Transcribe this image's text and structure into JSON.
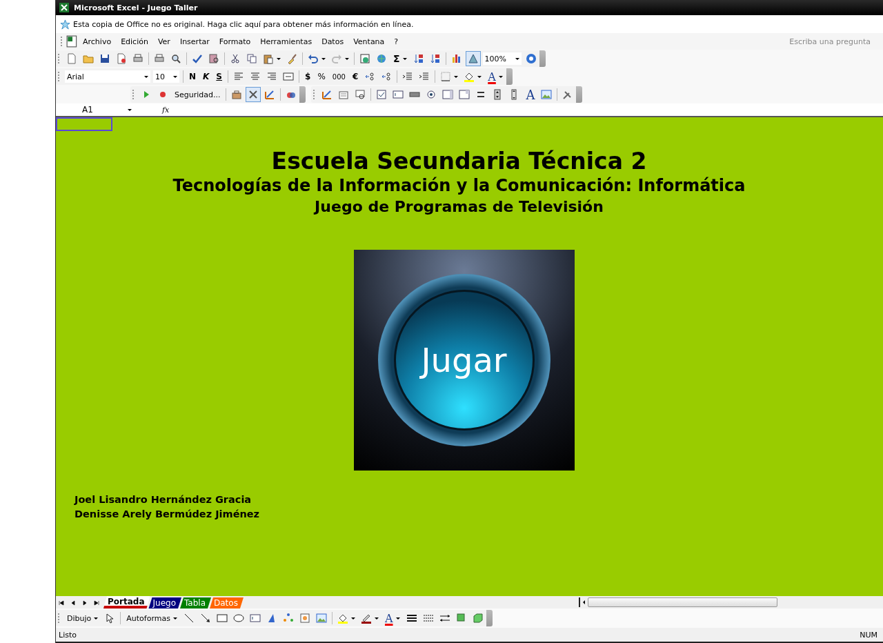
{
  "window": {
    "title": "Microsoft Excel - Juego Taller"
  },
  "notice": {
    "text": "Esta copia de Office no es original.  Haga clic aquí para obtener más información en línea."
  },
  "menu": [
    {
      "label": "Archivo"
    },
    {
      "label": "Edición"
    },
    {
      "label": "Ver"
    },
    {
      "label": "Insertar"
    },
    {
      "label": "Formato"
    },
    {
      "label": "Herramientas"
    },
    {
      "label": "Datos"
    },
    {
      "label": "Ventana"
    },
    {
      "label": "?"
    }
  ],
  "help_box": {
    "placeholder": "Escriba una pregunta"
  },
  "standard_toolbar": {
    "sum": "Σ",
    "zoom": "100%"
  },
  "formatting_toolbar": {
    "font": "Arial",
    "size": "10",
    "bold": "N",
    "italic": "K",
    "underline": "S",
    "currency": "$",
    "percent": "%",
    "thousands": "000",
    "euro": "€",
    "font_color": "A"
  },
  "controls_toolbar": {
    "security": "Seguridad...",
    "label_tool": "A"
  },
  "formula_bar": {
    "name_box": "A1",
    "fx": "fx"
  },
  "sheet": {
    "title": "Escuela Secundaria Técnica 2",
    "subtitle": "Tecnologías de la Información y la Comunicación: Informática",
    "heading": "Juego de Programas de Televisión",
    "button": "Jugar",
    "authors": [
      "Joel Lisandro Hernández Gracia",
      "Denisse Arely Bermúdez Jiménez"
    ]
  },
  "sheet_tabs": [
    {
      "label": "Portada",
      "selected": true,
      "color": "#c00000"
    },
    {
      "label": "Juego",
      "selected": false,
      "color": "#000080"
    },
    {
      "label": "Tabla",
      "selected": false,
      "color": "#008000"
    },
    {
      "label": "Datos",
      "selected": false,
      "color": "#ff6600"
    }
  ],
  "drawing_toolbar": {
    "draw": "Dibujo",
    "autoshapes": "Autoformas",
    "font_color": "A"
  },
  "status_bar": {
    "text": "Listo",
    "num": "NUM"
  }
}
